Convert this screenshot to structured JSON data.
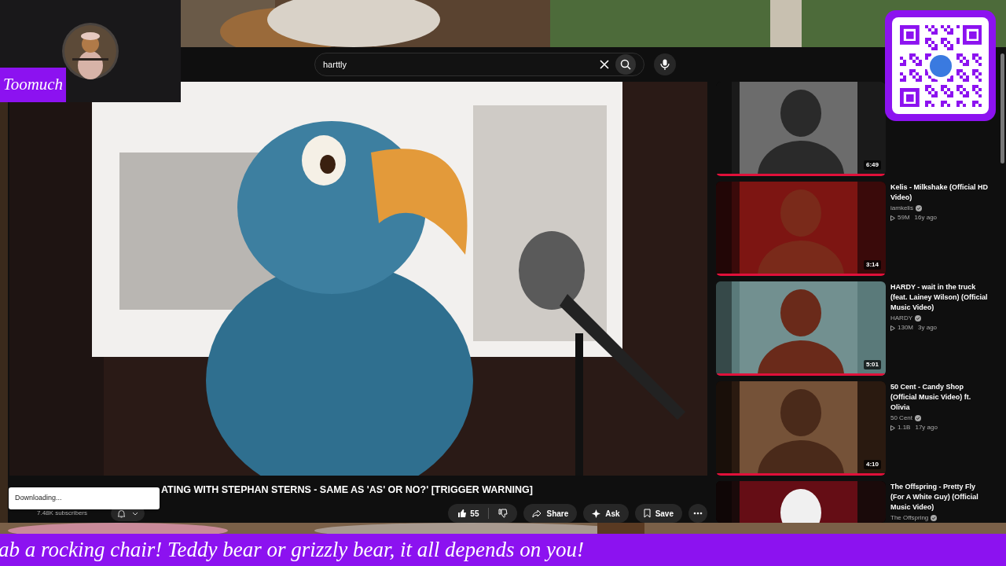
{
  "overlay": {
    "channel_label": "Toomuch"
  },
  "search": {
    "value": "harttly"
  },
  "video": {
    "title": "ATING WITH STEPHAN STERNS - SAME AS 'AS' OR NO?' [TRIGGER WARNING]",
    "subscribers": "7.48K subscribers",
    "likes": "55",
    "actions": [
      {
        "kind": "share",
        "label": "Share"
      },
      {
        "kind": "ask",
        "label": "Ask"
      },
      {
        "kind": "save",
        "label": "Save"
      }
    ]
  },
  "download_toast": "Downloading...",
  "recommended": [
    {
      "duration": "6:49",
      "level": 1
    },
    {
      "title": "Kelis - Milkshake (Official HD Video)",
      "channel": "iamkelis",
      "verified": true,
      "views": "59M",
      "age": "16y ago",
      "duration": "3:14",
      "level": 1
    },
    {
      "title": "HARDY - wait in the truck (feat. Lainey Wilson) (Official Music Video)",
      "channel": "HARDY",
      "verified": true,
      "views": "130M",
      "age": "3y ago",
      "duration": "5:01",
      "level": 1
    },
    {
      "title": "50 Cent - Candy Shop (Official Music Video) ft. Olivia",
      "channel": "50 Cent",
      "verified": true,
      "views": "1.1B",
      "age": "17y ago",
      "duration": "4:10",
      "level": 1
    },
    {
      "title": "The Offspring - Pretty Fly (For A White Guy) (Official Music Video)",
      "channel": "The Offspring",
      "verified": true
    }
  ],
  "ticker": "ab a rocking chair! Teddy bear or grizzly bear, it all depends on you!"
}
